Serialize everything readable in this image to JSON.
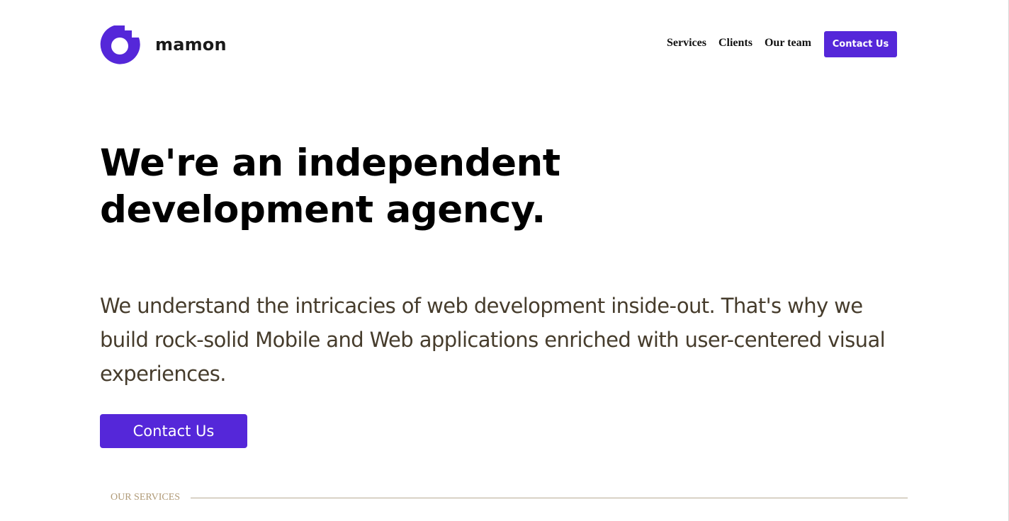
{
  "brand": {
    "name": "mamon",
    "logo_icon": "mamon-logo-icon",
    "accent_color": "#5527d9"
  },
  "nav": {
    "items": [
      "Services",
      "Clients",
      "Our team"
    ],
    "cta_label": "Contact Us"
  },
  "hero": {
    "headline": "We're an independent development agency.",
    "intro": "We understand the intricacies of web development inside-out. That's why we build rock-solid Mobile and Web applications enriched with user-centered visual experiences.",
    "cta_label": "Contact Us"
  },
  "services_section": {
    "label": "OUR SERVICES"
  }
}
